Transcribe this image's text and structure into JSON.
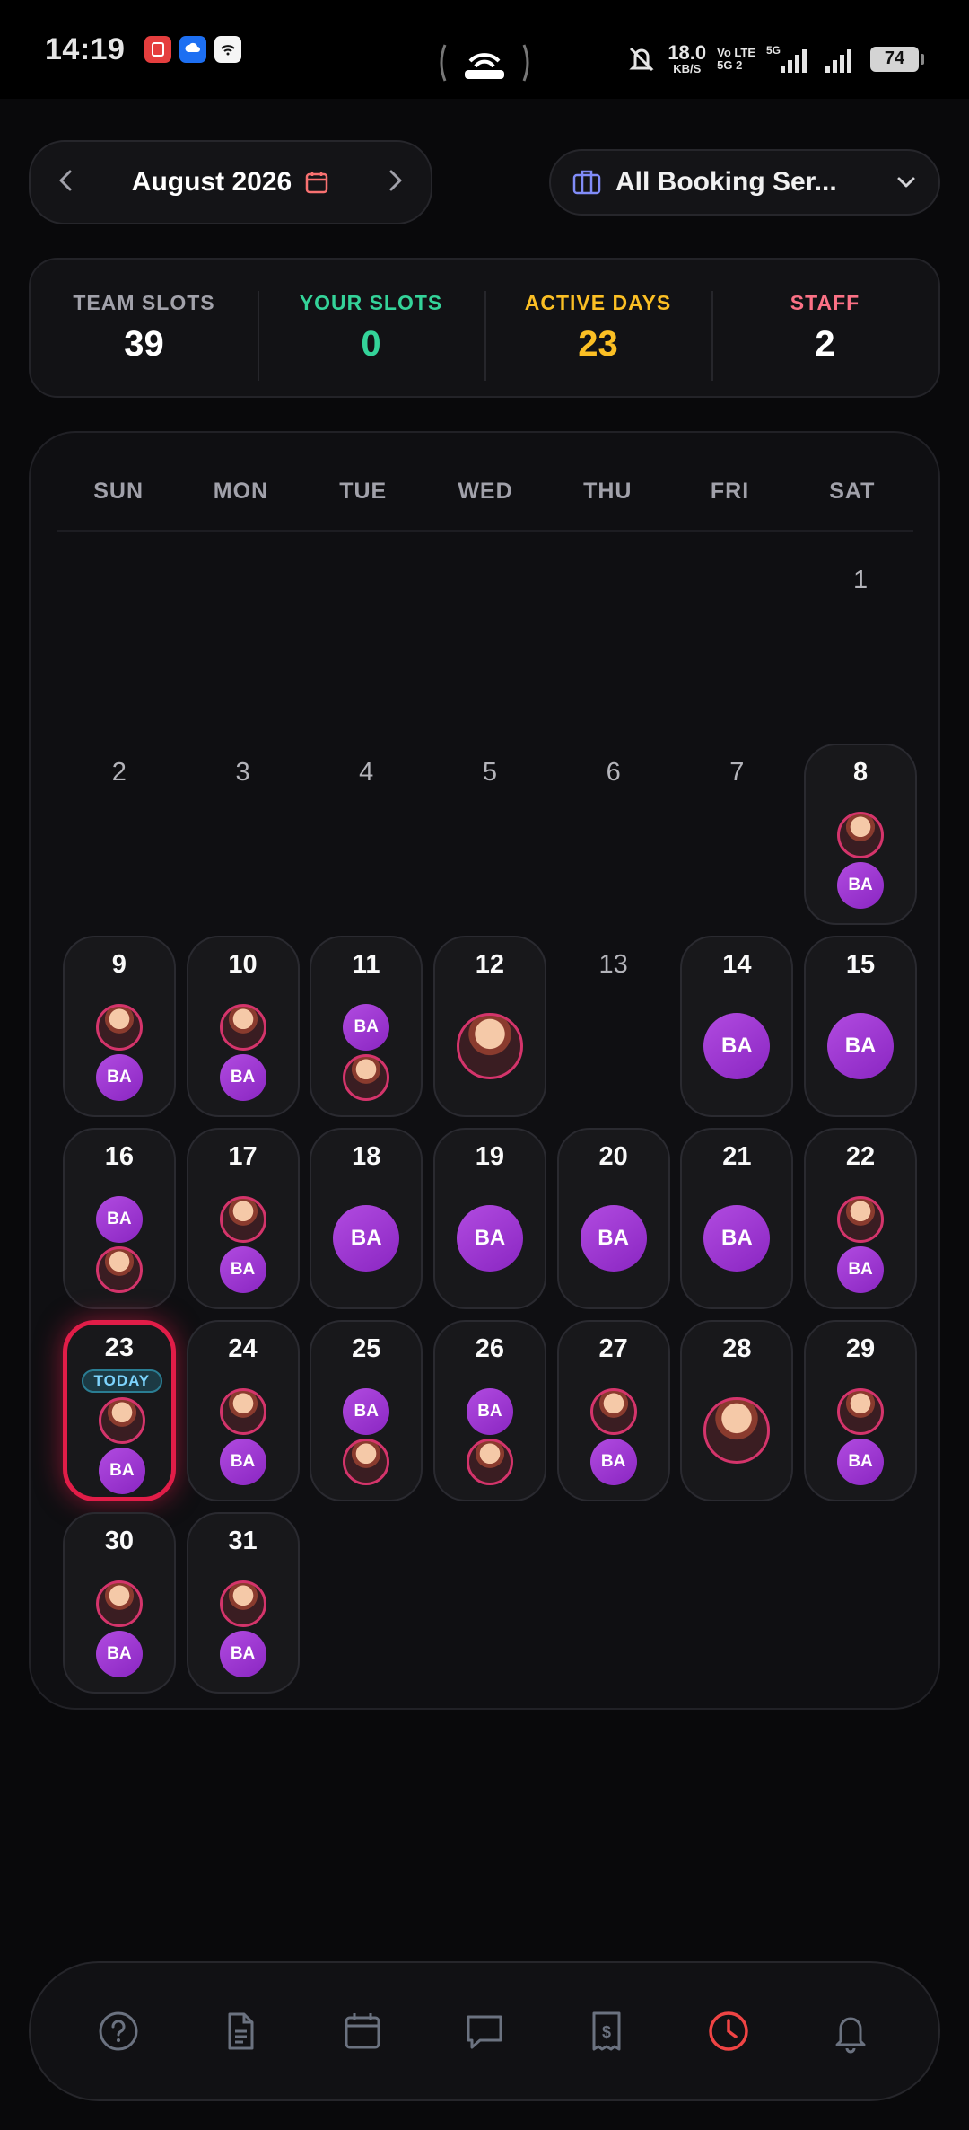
{
  "status_bar": {
    "time": "14:19",
    "speed_value": "18.0",
    "speed_unit": "KB/S",
    "volte_top": "Vo LTE",
    "volte_bottom": "5G 2",
    "network_label": "5G",
    "battery": "74"
  },
  "header": {
    "month_label": "August 2026",
    "service_label": "All Booking Ser..."
  },
  "stats": [
    {
      "key": "TEAM SLOTS",
      "value": "39",
      "color": "#a1a1aa",
      "value_color": "#ffffff"
    },
    {
      "key": "YOUR SLOTS",
      "value": "0",
      "color": "#34d399",
      "value_color": "#34d399"
    },
    {
      "key": "ACTIVE DAYS",
      "value": "23",
      "color": "#fbbf24",
      "value_color": "#fbbf24"
    },
    {
      "key": "STAFF",
      "value": "2",
      "color": "#fb7185",
      "value_color": "#ffffff"
    }
  ],
  "calendar": {
    "weekdays": [
      "SUN",
      "MON",
      "TUE",
      "WED",
      "THU",
      "FRI",
      "SAT"
    ],
    "today_badge": "TODAY",
    "staff_initials": "BA",
    "first_weekday_index": 6,
    "days": [
      {
        "day": "1",
        "active": false,
        "items": []
      },
      {
        "day": "2",
        "active": false,
        "items": []
      },
      {
        "day": "3",
        "active": false,
        "items": []
      },
      {
        "day": "4",
        "active": false,
        "items": []
      },
      {
        "day": "5",
        "active": false,
        "items": []
      },
      {
        "day": "6",
        "active": false,
        "items": []
      },
      {
        "day": "7",
        "active": false,
        "items": []
      },
      {
        "day": "8",
        "active": true,
        "items": [
          "photo",
          "ba"
        ]
      },
      {
        "day": "9",
        "active": true,
        "items": [
          "photo",
          "ba"
        ]
      },
      {
        "day": "10",
        "active": true,
        "items": [
          "photo",
          "ba"
        ]
      },
      {
        "day": "11",
        "active": true,
        "items": [
          "ba",
          "photo"
        ]
      },
      {
        "day": "12",
        "active": true,
        "items": [
          "photo-lg"
        ]
      },
      {
        "day": "13",
        "active": false,
        "items": []
      },
      {
        "day": "14",
        "active": true,
        "items": [
          "ba-lg"
        ]
      },
      {
        "day": "15",
        "active": true,
        "items": [
          "ba-lg"
        ]
      },
      {
        "day": "16",
        "active": true,
        "items": [
          "ba",
          "photo"
        ]
      },
      {
        "day": "17",
        "active": true,
        "items": [
          "photo",
          "ba"
        ]
      },
      {
        "day": "18",
        "active": true,
        "items": [
          "ba-lg"
        ]
      },
      {
        "day": "19",
        "active": true,
        "items": [
          "ba-lg"
        ]
      },
      {
        "day": "20",
        "active": true,
        "items": [
          "ba-lg"
        ]
      },
      {
        "day": "21",
        "active": true,
        "items": [
          "ba-lg"
        ]
      },
      {
        "day": "22",
        "active": true,
        "items": [
          "photo",
          "ba"
        ]
      },
      {
        "day": "23",
        "active": true,
        "today": true,
        "items": [
          "photo",
          "ba"
        ]
      },
      {
        "day": "24",
        "active": true,
        "items": [
          "photo",
          "ba"
        ]
      },
      {
        "day": "25",
        "active": true,
        "items": [
          "ba",
          "photo"
        ]
      },
      {
        "day": "26",
        "active": true,
        "items": [
          "ba",
          "photo"
        ]
      },
      {
        "day": "27",
        "active": true,
        "items": [
          "photo",
          "ba"
        ]
      },
      {
        "day": "28",
        "active": true,
        "items": [
          "photo-lg"
        ]
      },
      {
        "day": "29",
        "active": true,
        "items": [
          "photo",
          "ba"
        ]
      },
      {
        "day": "30",
        "active": true,
        "items": [
          "photo",
          "ba"
        ]
      },
      {
        "day": "31",
        "active": true,
        "items": [
          "photo",
          "ba"
        ]
      }
    ]
  },
  "bottom_nav": [
    {
      "icon": "help-icon",
      "active": false
    },
    {
      "icon": "document-icon",
      "active": false
    },
    {
      "icon": "calendar-icon",
      "active": false
    },
    {
      "icon": "chat-icon",
      "active": false
    },
    {
      "icon": "receipt-icon",
      "active": false
    },
    {
      "icon": "clock-icon",
      "active": true
    },
    {
      "icon": "bell-icon",
      "active": false
    }
  ],
  "colors": {
    "accent_red": "#ef4444",
    "today_border": "#e11d48",
    "ba_purple": "#a855f7",
    "icon_gray": "#6b7280"
  }
}
